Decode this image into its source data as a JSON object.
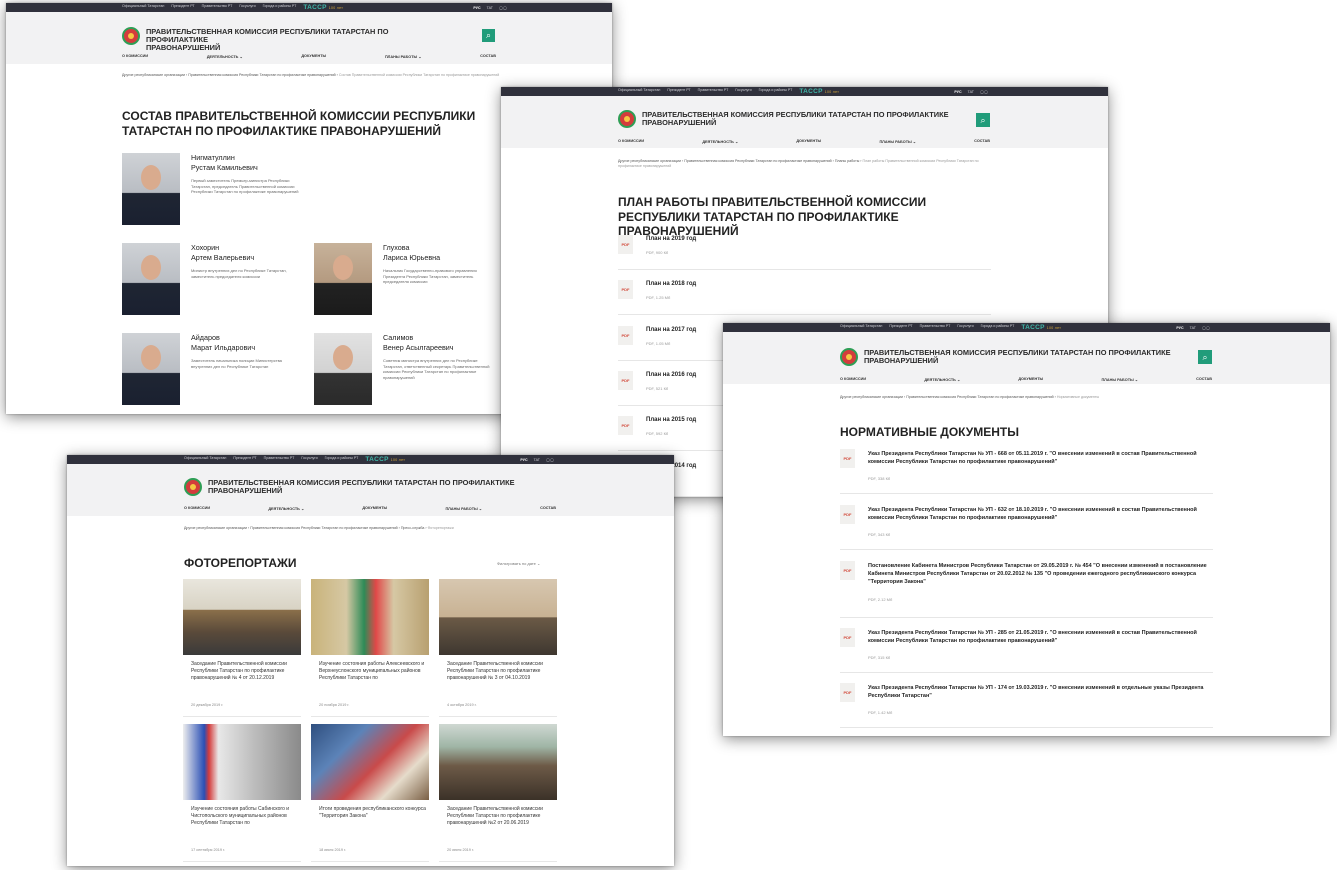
{
  "topbar": {
    "links": [
      "Официальный Татарстан",
      "Президент РТ",
      "Правительство РТ",
      "Госуслуги",
      "Города и районы РТ"
    ],
    "brand": "TAССР",
    "brand_sub": "100 лет",
    "lang_active": "РУС",
    "lang_other": "ТАТ",
    "accessibility": "◯◯"
  },
  "site": {
    "title": "ПРАВИТЕЛЬСТВЕННАЯ КОМИССИЯ РЕСПУБЛИКИ ТАТАРСТАН ПО ПРОФИЛАКТИКЕ ПРАВОНАРУШЕНИЙ",
    "title_line1": "ПРАВИТЕЛЬСТВЕННАЯ КОМИССИЯ РЕСПУБЛИКИ ТАТАРСТАН ПО ПРОФИЛАКТИКЕ",
    "title_line2": "ПРАВОНАРУШЕНИЙ",
    "search_icon": "⌕"
  },
  "menu": {
    "about": "О КОМИССИИ",
    "activity": "ДЕЯТЕЛЬНОСТЬ ⌄",
    "docs": "ДОКУМЕНТЫ",
    "plans": "ПЛАНЫ РАБОТЫ ⌄",
    "members": "СОСТАВ"
  },
  "crumbs": {
    "root": "Другие республиканские организации",
    "commission": "Правительственная комиссия Республики Татарстан по профилактике правонарушений",
    "sep": "›",
    "members_cur": "Состав Правительственной комиссии Республики Татарстан по профилактике правонарушений",
    "plans_mid": "Планы работы",
    "plans_cur": "План работы Правительственной комиссии Республики Татарстан по профилактике правонарушений",
    "norm_cur": "Нормативные документы",
    "press": "Пресс-служба",
    "photo_cur": "Фоторепортажи"
  },
  "members_page": {
    "title": "СОСТАВ ПРАВИТЕЛЬСТВЕННОЙ КОМИССИИ РЕСПУБЛИКИ ТАТАРСТАН ПО ПРОФИЛАКТИКЕ ПРАВОНАРУШЕНИЙ",
    "people": [
      {
        "surname": "Нигматуллин",
        "name": "Рустам Камильевич",
        "desc": "Первый заместитель Премьер-министра Республики Татарстан, председатель Правительственной комиссии Республики Татарстан по профилактике правонарушений"
      },
      {
        "surname": "Хохорин",
        "name": "Артем Валерьевич",
        "desc": "Министр внутренних дел по Республике Татарстан, заместитель председателя комиссии"
      },
      {
        "surname": "Глухова",
        "name": "Лариса Юрьевна",
        "desc": "Начальник Государственно-правового управления Президента Республики Татарстан, заместитель председателя комиссии"
      },
      {
        "surname": "Айдаров",
        "name": "Марат Ильдарович",
        "desc": "Заместитель начальника полиции Министерства внутренних дел по Республике Татарстан"
      },
      {
        "surname": "Салимов",
        "name": "Венер Асылгареевич",
        "desc": "Советник министра внутренних дел по Республике Татарстан, ответственный секретарь Правительственной комиссии Республики Татарстан по профилактике правонарушений"
      }
    ]
  },
  "plans_page": {
    "title": "ПЛАН РАБОТЫ ПРАВИТЕЛЬСТВЕННОЙ КОМИССИИ РЕСПУБЛИКИ ТАТАРСТАН ПО ПРОФИЛАКТИКЕ ПРАВОНАРУШЕНИЙ",
    "pdf": "PDF",
    "items": [
      {
        "title": "План на 2019 год",
        "meta": "PDF, 900 Кб"
      },
      {
        "title": "План на 2018 год",
        "meta": "PDF, 1.25 Мб"
      },
      {
        "title": "План на 2017 год",
        "meta": "PDF, 1.05 Мб"
      },
      {
        "title": "План на 2016 год",
        "meta": "PDF, 521 Кб"
      },
      {
        "title": "План на 2015 год",
        "meta": "PDF, 592 Кб"
      },
      {
        "title": "План на 2014 год",
        "meta": "PDF, 510 Кб"
      }
    ]
  },
  "norm_page": {
    "title": "НОРМАТИВНЫЕ ДОКУМЕНТЫ",
    "pdf": "PDF",
    "items": [
      {
        "title": "Указ Президента Республики Татарстан № УП - 668 от 05.11.2019 г. \"О внесении изменений в состав Правительственной комиссии Республики Татарстан по профилактике правонарушений\"",
        "meta": "PDF, 338 Кб"
      },
      {
        "title": "Указ Президента Республики Татарстан № УП - 632 от 18.10.2019 г. \"О внесении изменений в состав Правительственной комиссии Республики Татарстан по профилактике правонарушений\"",
        "meta": "PDF, 343 Кб"
      },
      {
        "title": "Постановление Кабинета Министров Республики Татарстан от 29.05.2019 г. № 454 \"О внесении изменений в постановление Кабинета Министров Республики Татарстан от 20.02.2012 № 135 \"О проведении ежегодного республиканского конкурса \"Территория Закона\"",
        "meta": "PDF, 2.12 Мб"
      },
      {
        "title": "Указ Президента Республики Татарстан № УП - 285 от 21.05.2019 г. \"О внесении изменений в состав Правительственной комиссии Республики Татарстан по профилактике правонарушений\"",
        "meta": "PDF, 315 Кб"
      },
      {
        "title": "Указ Президента Республики Татарстан № УП - 174 от 19.03.2019 г. \"О внесении изменений в отдельные указы Президента Республики Татарстан\"",
        "meta": "PDF, 1.42 Мб"
      }
    ]
  },
  "photo_page": {
    "title": "ФОТОРЕПОРТАЖИ",
    "filter": "Фильтровать по дате ⌄",
    "tiles": [
      {
        "title": "Заседание Правительственной комиссии Республики Татарстан по профилактике правонарушений № 4 от 20.12.2019",
        "date": "20 декабря 2019 г."
      },
      {
        "title": "Изучение состояния работы Алексеевского и Верхнеуслонского муниципальных районов Республики Татарстан по",
        "date": "20 ноября 2019 г."
      },
      {
        "title": "Заседание Правительственной комиссии Республики Татарстан по профилактике правонарушений № 3 от 04.10.2019",
        "date": "4 октября 2019 г."
      },
      {
        "title": "Изучение состояния работы Сабинского и Чистопольского муниципальных районов Республики Татарстан по",
        "date": "17 сентября 2019 г."
      },
      {
        "title": "Итоги проведения республиканского конкурса \"Территория Закона\"",
        "date": "18 июля 2019 г."
      },
      {
        "title": "Заседание Правительственной комиссии Республики Татарстан по профилактике правонарушений №2 от 20.06.2019",
        "date": "20 июня 2019 г."
      }
    ]
  }
}
